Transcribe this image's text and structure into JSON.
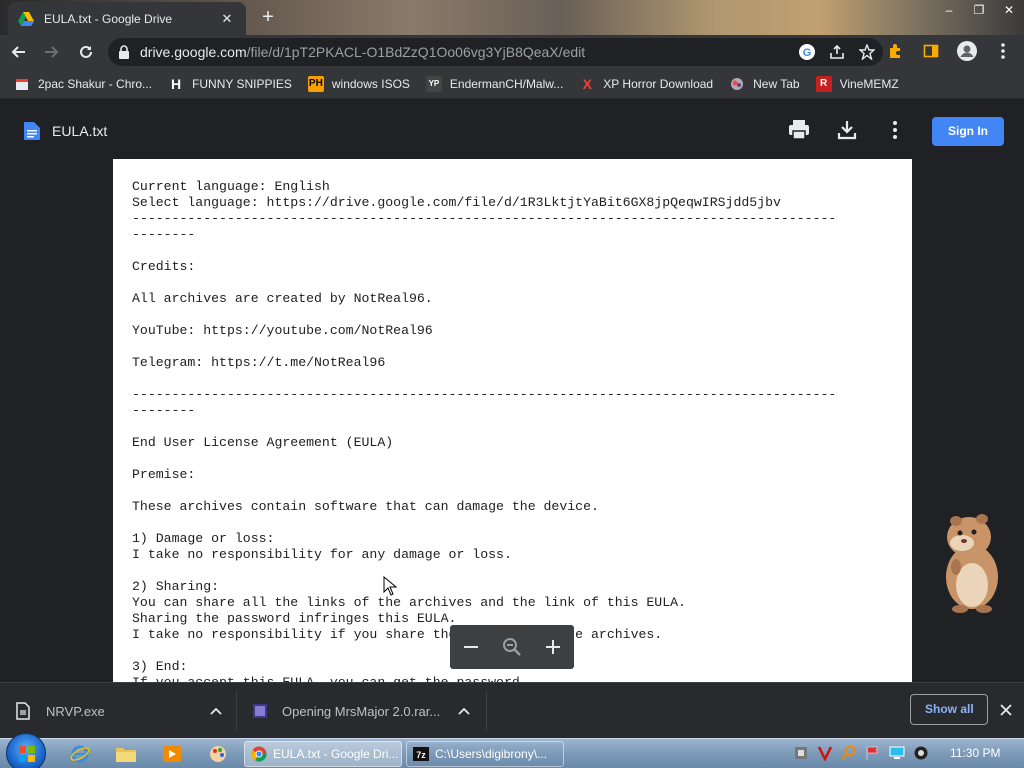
{
  "browser": {
    "tab": {
      "title": "EULA.txt - Google Drive"
    },
    "url": {
      "host": "drive.google.com",
      "path": "/file/d/1pT2PKACL-O1BdZzQ1Oo06vg3YjB8QeaX/edit"
    },
    "bookmarks": [
      {
        "label": "2pac Shakur - Chro...",
        "icon": "calendar-icon",
        "glyph": "",
        "color": "#ea4335"
      },
      {
        "label": "FUNNY SNIPPIES",
        "icon": "h-logo-icon",
        "glyph": "H",
        "color": "#ffffff"
      },
      {
        "label": "windows ISOS",
        "icon": "ph-logo-icon",
        "glyph": "PH",
        "color": "#f9a000"
      },
      {
        "label": "EndermanCH/Malw...",
        "icon": "yp-logo-icon",
        "glyph": "YP",
        "color": "#555555"
      },
      {
        "label": "XP Horror Download",
        "icon": "x-logo-icon",
        "glyph": "X",
        "color": "#ea4335"
      },
      {
        "label": "New Tab",
        "icon": "globe-icon",
        "glyph": "",
        "color": "#9a8aa0"
      },
      {
        "label": "VineMEMZ",
        "icon": "r-logo-icon",
        "glyph": "R",
        "color": "#c5221f"
      }
    ]
  },
  "viewer": {
    "file_name": "EULA.txt",
    "sign_in": "Sign In",
    "lines": [
      "Current language: English",
      "Select language: https://drive.google.com/file/d/1R3LktjtYaBit6GX8jpQeqwIRSjdd5jbv",
      "-----------------------------------------------------------------------------------------",
      "--------",
      "",
      "Credits:",
      "",
      "All archives are created by NotReal96.",
      "",
      "YouTube: https://youtube.com/NotReal96",
      "",
      "Telegram: https://t.me/NotReal96",
      "",
      "-----------------------------------------------------------------------------------------",
      "--------",
      "",
      "End User License Agreement (EULA)",
      "",
      "Premise:",
      "",
      "These archives contain software that can damage the device.",
      "",
      "1) Damage or loss:",
      "I take no responsibility for any damage or loss.",
      "",
      "2) Sharing:",
      "You can share all the links of the archives and the link of this EULA.",
      "Sharing the password infringes this EULA.",
      "I take no responsibility if you share the contents of the archives.",
      "",
      "3) End:",
      "If you accept this EULA, you can get the password."
    ]
  },
  "downloads": {
    "items": [
      {
        "name": "NRVP.exe"
      },
      {
        "name": "Opening MrsMajor 2.0.rar..."
      }
    ],
    "show_all": "Show all"
  },
  "taskbar": {
    "tasks": [
      {
        "label": "EULA.txt - Google Dri..."
      },
      {
        "label": "C:\\Users\\digibrony\\..."
      }
    ],
    "clock": "11:30 PM"
  }
}
